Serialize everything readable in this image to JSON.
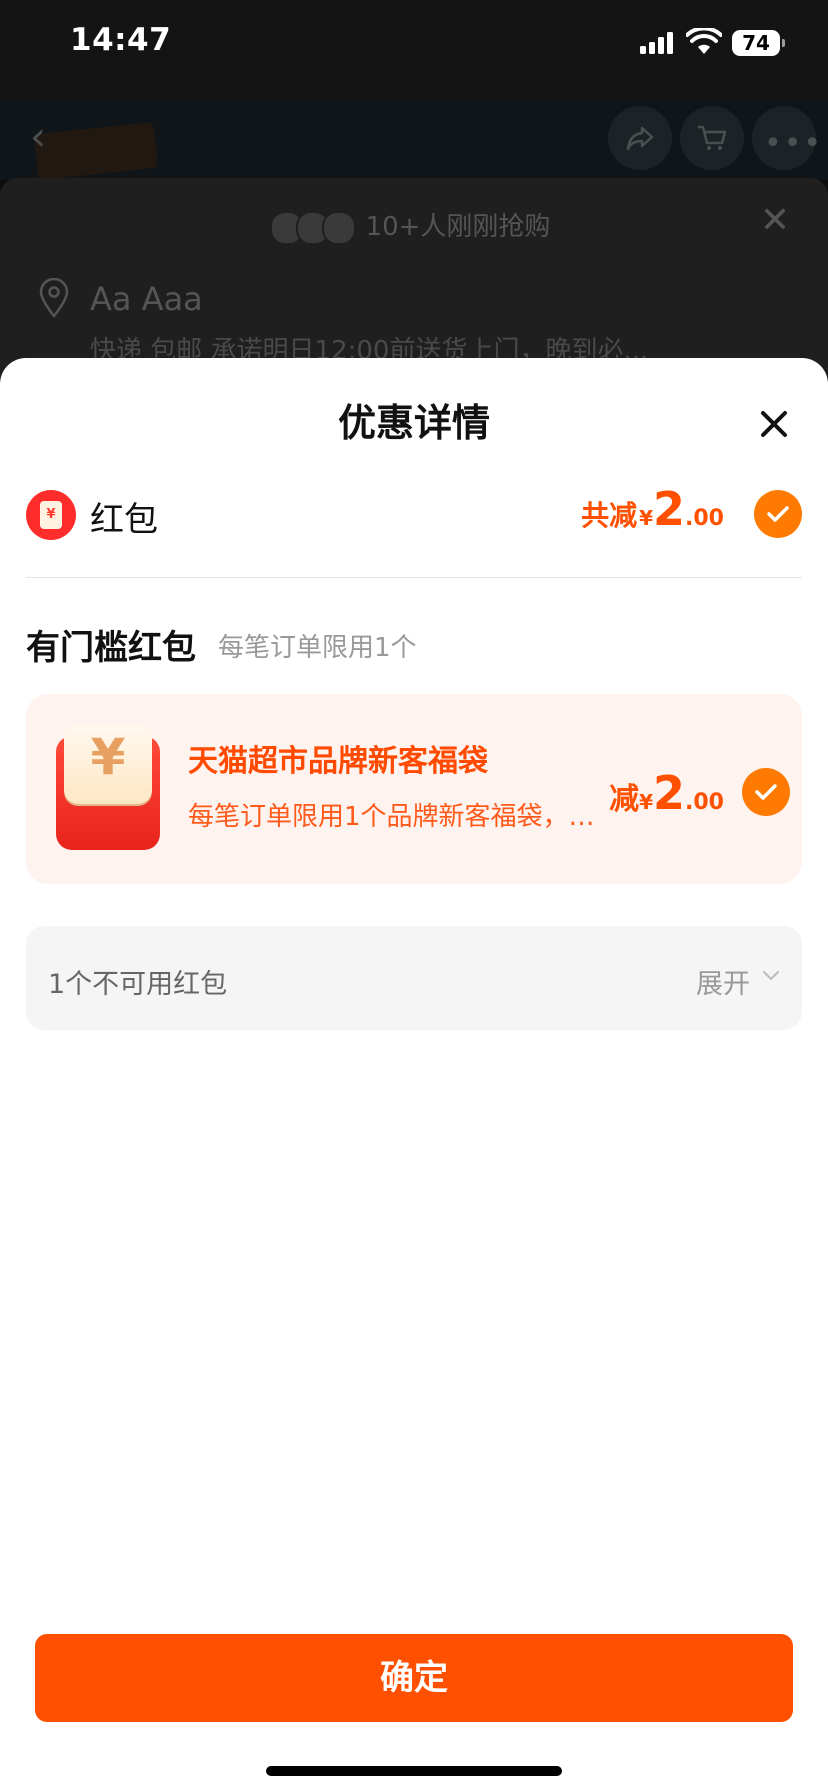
{
  "status_bar": {
    "time": "14:47",
    "battery_level": "74"
  },
  "background_page": {
    "recent_buyers_text": "10+人刚刚抢购",
    "address_name": "Aa Aaa",
    "delivery_text": "快递 包邮 承诺明日12:00前送货上门，晚到必..."
  },
  "sheet": {
    "title": "优惠详情",
    "red_packet": {
      "label": "红包",
      "icon_glyph": "¥",
      "total_label": "共减",
      "currency": "¥",
      "amount_int": "2",
      "amount_dec": ".00",
      "selected": true
    },
    "threshold_section": {
      "title": "有门槛红包",
      "subtitle": "每笔订单限用1个"
    },
    "coupon": {
      "title": "天猫超市品牌新客福袋",
      "description": "每笔订单限用1个品牌新客福袋，满...",
      "amount_label": "减",
      "currency": "¥",
      "amount_int": "2",
      "amount_dec": ".00",
      "icon_glyph": "¥",
      "selected": true
    },
    "unavailable": {
      "label": "1个不可用红包",
      "expand_label": "展开"
    },
    "confirm_label": "确定"
  },
  "colors": {
    "accent": "#ff5000",
    "check": "#ff7a00",
    "coupon_bg": "#fff3f0"
  }
}
